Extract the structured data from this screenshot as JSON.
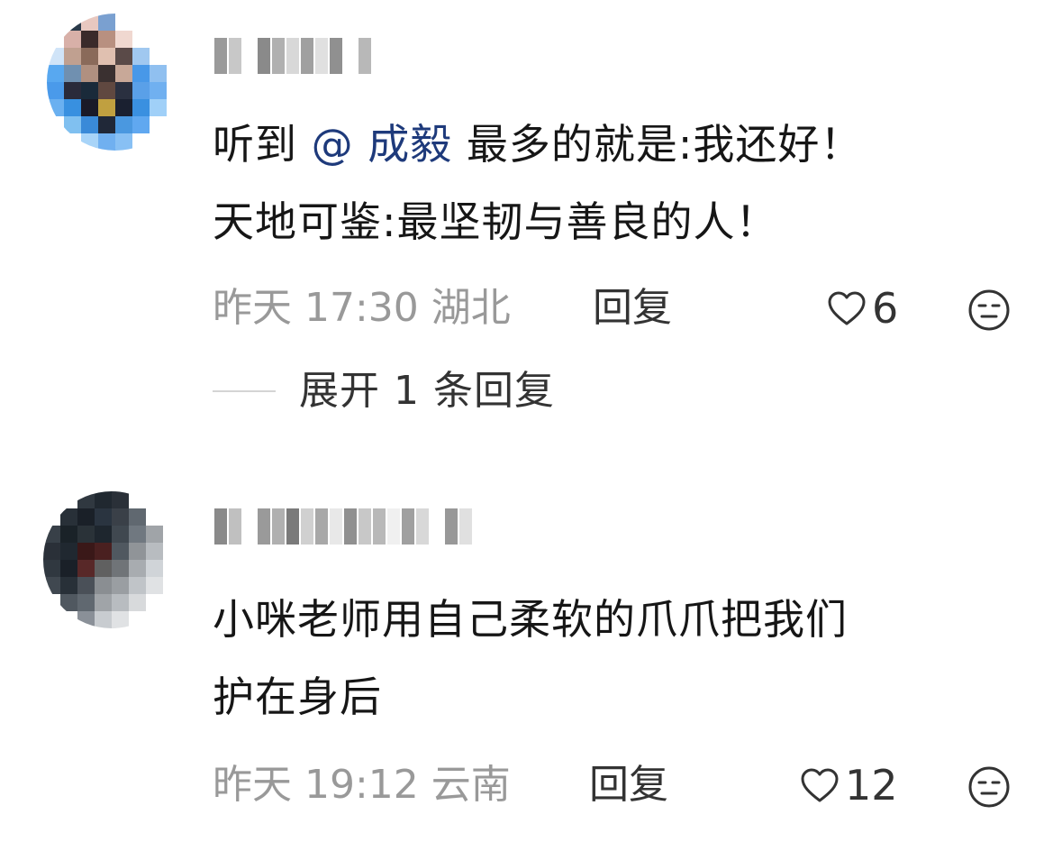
{
  "comments": [
    {
      "username": "",
      "text_line1_pre": "听到",
      "mention": "@ 成毅",
      "text_line1_post": " 最多的就是:我还好！",
      "text_line2": "天地可鉴:最坚韧与善良的人！",
      "time": "昨天 17:30 湖北",
      "reply_label": "回复",
      "likes": "6",
      "expand_label": "展开 1 条回复",
      "avatar_palette": [
        "#ffffff",
        "#2a3a4a",
        "#e8c8c0",
        "#7aa0d0",
        "#ffffff",
        "#ffffff",
        "#ffffff",
        "#ffffff",
        "#ffffff",
        "#d8b0a8",
        "#3a2a2a",
        "#b89080",
        "#f0d8d0",
        "#ffffff",
        "#ffffff",
        "#ffffff",
        "#d0e4f8",
        "#c0a090",
        "#8a6a5a",
        "#e0c0b0",
        "#5a4a48",
        "#a0c8f0",
        "#ffffff",
        "#ffffff",
        "#58a8f0",
        "#7090b0",
        "#b09080",
        "#3a3030",
        "#c8a898",
        "#4898e8",
        "#90c0f0",
        "#ffffff",
        "#4a9aea",
        "#2a2a3a",
        "#1a2a3a",
        "#604840",
        "#2a3040",
        "#5aa0e8",
        "#70b0f0",
        "#ffffff",
        "#6ab0f0",
        "#3890e0",
        "#1a1a28",
        "#c0a040",
        "#1a2030",
        "#3a90e0",
        "#a0d0f8",
        "#ffffff",
        "#ffffff",
        "#80c0f0",
        "#3a8ad8",
        "#202838",
        "#4a98e0",
        "#60a8f0",
        "#ffffff",
        "#ffffff",
        "#ffffff",
        "#ffffff",
        "#a8d4f8",
        "#70b0f0",
        "#88c0f4",
        "#ffffff",
        "#ffffff",
        "#ffffff"
      ]
    },
    {
      "username": "",
      "text_line1": "小咪老师用自己柔软的爪爪把我们",
      "text_line2": "护在身后",
      "time": "昨天 19:12 云南",
      "reply_label": "回复",
      "likes": "12",
      "avatar_palette": [
        "#ffffff",
        "#ffffff",
        "#303840",
        "#202830",
        "#2a3038",
        "#ffffff",
        "#ffffff",
        "#ffffff",
        "#ffffff",
        "#283038",
        "#1a2028",
        "#2a3440",
        "#3a4048",
        "#606870",
        "#ffffff",
        "#ffffff",
        "#384048",
        "#1a2228",
        "#2a3238",
        "#1e262e",
        "#404850",
        "#707880",
        "#a0a4a8",
        "#ffffff",
        "#2a3038",
        "#202830",
        "#3a1818",
        "#4a2020",
        "#505860",
        "#909498",
        "#b8bcc0",
        "#ffffff",
        "#303840",
        "#1a2028",
        "#582828",
        "#606060",
        "#707478",
        "#a8acb0",
        "#d0d4d8",
        "#ffffff",
        "#404850",
        "#283038",
        "#4a5058",
        "#8a8e92",
        "#9a9ea2",
        "#c0c4c8",
        "#e0e2e4",
        "#ffffff",
        "#ffffff",
        "#505860",
        "#606870",
        "#a0a4a8",
        "#b8bcc0",
        "#d8dadc",
        "#ffffff",
        "#ffffff",
        "#ffffff",
        "#ffffff",
        "#8a9098",
        "#c8ccd0",
        "#e0e2e4",
        "#ffffff",
        "#ffffff",
        "#ffffff"
      ]
    }
  ],
  "username_palettes": [
    [
      "#9a9a9a",
      "#c8c8c8",
      "#ffffff",
      "#8a8a8a",
      "#b0b0b0",
      "#d8d8d8",
      "#a0a0a0",
      "#e0e0e0",
      "#909090",
      "#ffffff",
      "#b8b8b8"
    ],
    [
      "#8a8a8a",
      "#c0c0c0",
      "#ffffff",
      "#9a9a9a",
      "#b0b0b0",
      "#7a7a7a",
      "#d0d0d0",
      "#a8a8a8",
      "#e8e8e8",
      "#909090",
      "#c8c8c8",
      "#b8b8b8",
      "#f0f0f0",
      "#a0a0a0",
      "#d8d8d8",
      "#ffffff",
      "#989898",
      "#e0e0e0"
    ]
  ]
}
